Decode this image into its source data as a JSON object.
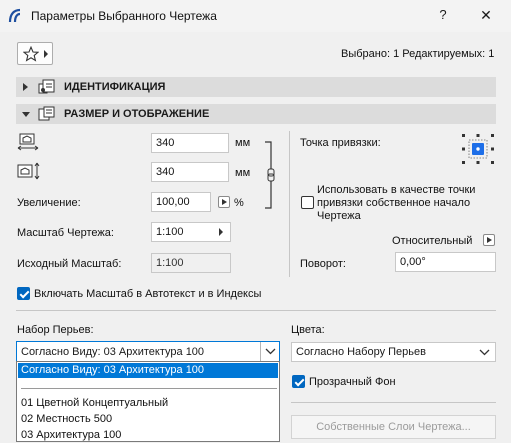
{
  "window": {
    "title": "Параметры Выбранного Чертежа",
    "help": "?",
    "close": "✕"
  },
  "toolbar": {
    "selected_info": "Выбрано: 1 Редактируемых: 1"
  },
  "sections": {
    "identification": "ИДЕНТИФИКАЦИЯ",
    "size_display": "РАЗМЕР И ОТОБРАЖЕНИЕ"
  },
  "size": {
    "width_value": "340",
    "height_value": "340",
    "unit_mm": "мм",
    "zoom_label": "Увеличение:",
    "zoom_value": "100,00",
    "zoom_unit": "%",
    "scale_label": "Масштаб Чертежа:",
    "scale_value": "1:100",
    "orig_scale_label": "Исходный Масштаб:",
    "orig_scale_value": "1:100"
  },
  "anchor": {
    "label": "Точка привязки:",
    "use_origin_label": "Использовать в качестве точки привязки собственное начало Чертежа",
    "use_origin_checked": false,
    "relative_label": "Относительный",
    "rotation_label": "Поворот:",
    "rotation_value": "0,00°"
  },
  "autotext": {
    "label": "Включать Масштаб в Автотекст и в Индексы",
    "checked": true
  },
  "pens": {
    "label": "Набор Перьев:",
    "selected": "Согласно Виду: 03 Архитектура 100",
    "options": [
      "Согласно Виду: 03 Архитектура 100",
      "01 Цветной Концептуальный",
      "02 Местность 500",
      "03 Архитектура 100"
    ]
  },
  "colors": {
    "label": "Цвета:",
    "value": "Согласно Набору Перьев",
    "transparent_label": "Прозрачный Фон",
    "transparent_checked": true,
    "layers_button": "Собственные Слои Чертежа..."
  }
}
